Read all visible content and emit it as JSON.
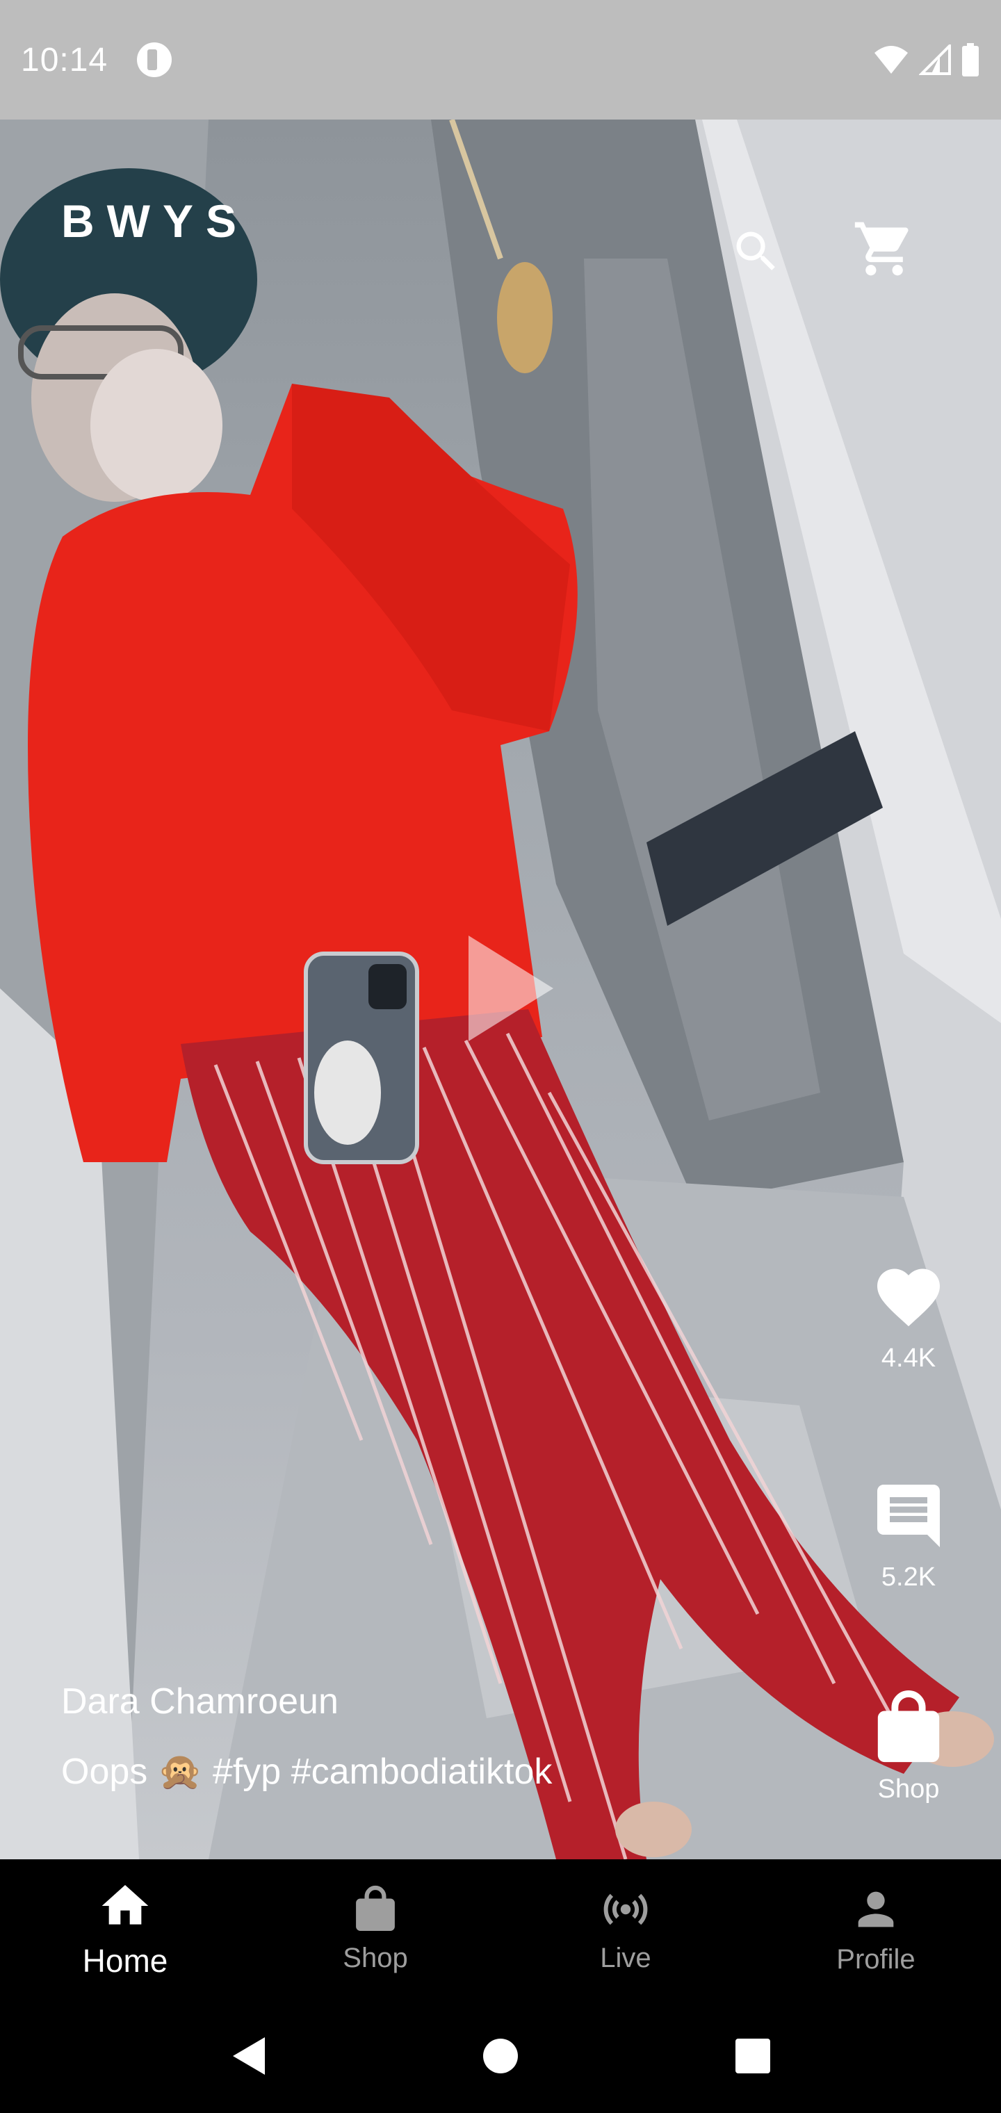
{
  "status_bar": {
    "time": "10:14"
  },
  "header": {
    "logo": "BWYS",
    "search_icon": "search-icon",
    "cart_icon": "cart-icon"
  },
  "video": {
    "play_icon": "play-icon",
    "author": "Dara Chamroeun",
    "caption": "Oops 🙊 #fyp #cambodiatiktok"
  },
  "actions": {
    "likes": "4.4K",
    "comments": "5.2K",
    "shop_label": "Shop"
  },
  "bottom_nav": {
    "items": [
      {
        "label": "Home",
        "icon": "home-icon",
        "active": true
      },
      {
        "label": "Shop",
        "icon": "shopping-bag-icon",
        "active": false
      },
      {
        "label": "Live",
        "icon": "live-broadcast-icon",
        "active": false
      },
      {
        "label": "Profile",
        "icon": "person-icon",
        "active": false
      }
    ]
  },
  "colors": {
    "status_bar_bg": "#bdbdbd",
    "nav_bg": "#000000",
    "active_text": "#ffffff",
    "inactive_text": "#9e9e9e",
    "shirt": "#e8241a",
    "pants": "#b5202a"
  }
}
